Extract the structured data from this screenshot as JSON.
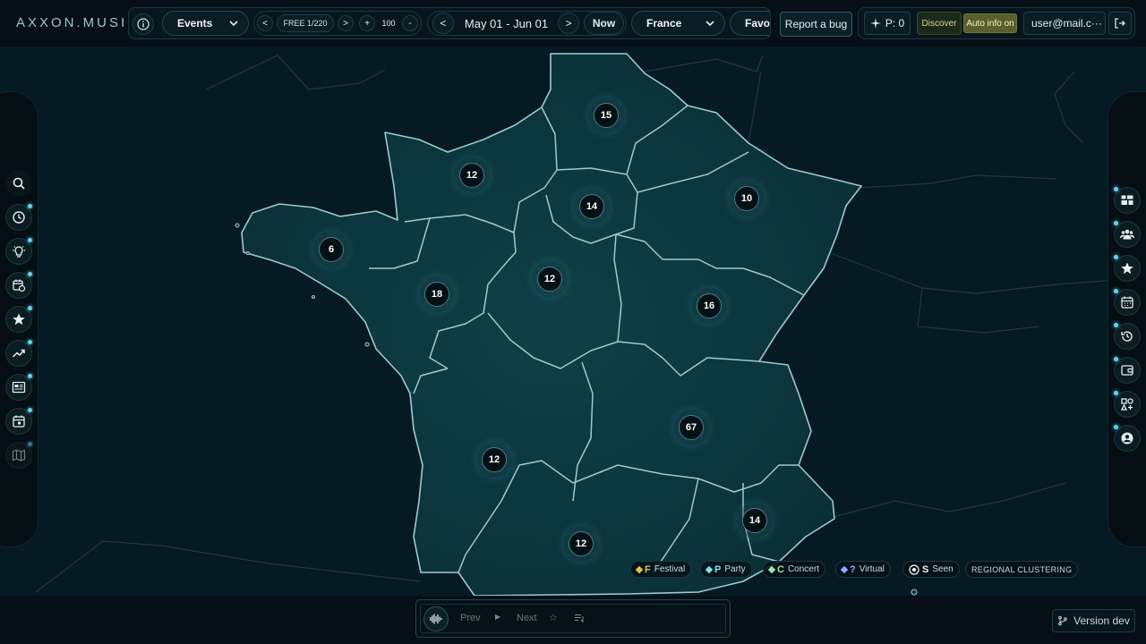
{
  "app": {
    "logo": "AXXON.MUSIC"
  },
  "header": {
    "mode_select": "Events",
    "quota_badge": "FREE 1/220",
    "prev_quota": "<",
    "next_quota": ">",
    "plus_label": "+",
    "limit_value": "100",
    "minus_label": "-",
    "date_prev": "<",
    "date_range": "May 01 - Jun 01",
    "date_next": ">",
    "now_label": "Now",
    "country_select": "France",
    "favorites_label": "Favor",
    "report_bug_label": "Report a bug",
    "points_label": "P: 0",
    "discover_label": "Discover",
    "auto_info_label": "Auto info on",
    "user_email": "user@mail.c···"
  },
  "clusters": [
    {
      "count": "15"
    },
    {
      "count": "12"
    },
    {
      "count": "14"
    },
    {
      "count": "10"
    },
    {
      "count": "6"
    },
    {
      "count": "18"
    },
    {
      "count": "12"
    },
    {
      "count": "16"
    },
    {
      "count": "67"
    },
    {
      "count": "12"
    },
    {
      "count": "14"
    },
    {
      "count": "12"
    }
  ],
  "legend": [
    {
      "letter": "F",
      "label": "Festival",
      "color": "#e8c24a"
    },
    {
      "letter": "P",
      "label": "Party",
      "color": "#7fe0f0"
    },
    {
      "letter": "C",
      "label": "Concert",
      "color": "#9ae6a8"
    },
    {
      "letter": "?",
      "label": "Virtual",
      "color": "#9aa6ff"
    },
    {
      "letter": "S",
      "label": "Seen",
      "color": "#ffffff"
    }
  ],
  "regional_clustering_label": "REGIONAL CLUSTERING",
  "player": {
    "prev_label": "Prev",
    "next_label": "Next"
  },
  "version_label": "Version dev",
  "left_rail_icons": [
    "search-icon",
    "clock-icon",
    "lightbulb-icon",
    "calendar-clock-icon",
    "star-icon",
    "trending-icon",
    "news-icon",
    "calendar-icon",
    "map-icon"
  ],
  "right_rail_icons": [
    "dashboard-icon",
    "users-icon",
    "star-icon",
    "calendar-icon",
    "history-icon",
    "wallet-icon",
    "shapes-icon",
    "user-circle-icon"
  ],
  "colors": {
    "accent": "#62d4ea",
    "map_fill": "#0d3a3f",
    "map_border": "#9cc8cf"
  }
}
